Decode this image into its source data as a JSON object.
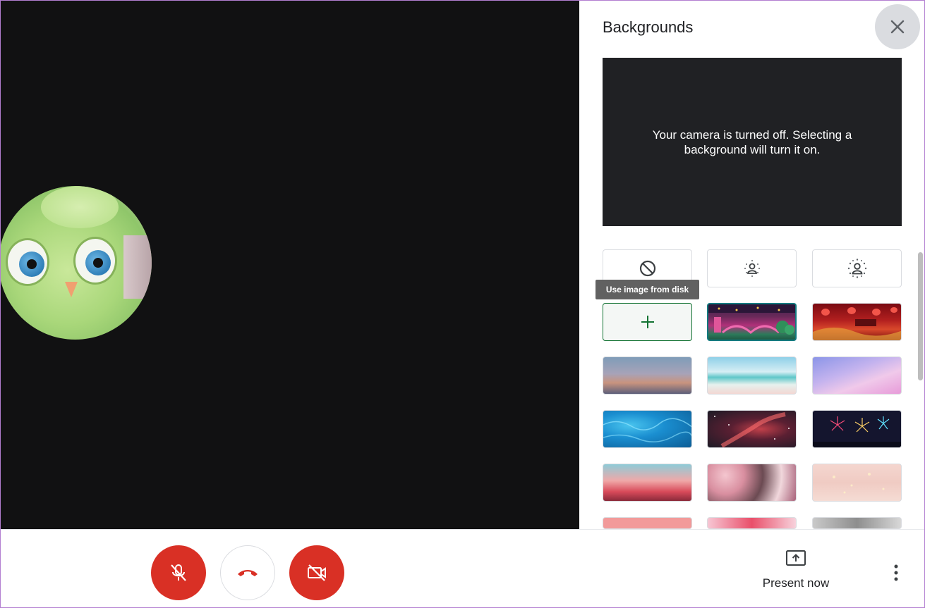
{
  "panel": {
    "title": "Backgrounds",
    "preview_message": "Your camera is turned off. Selecting a background will turn it on.",
    "tooltip": "Use image from disk",
    "options": [
      {
        "name": "no-effect",
        "icon": "block-icon"
      },
      {
        "name": "slight-blur",
        "icon": "blur-person-icon"
      },
      {
        "name": "blur",
        "icon": "blur-person-icon"
      }
    ],
    "add_icon": "plus-icon",
    "backgrounds": [
      {
        "name": "night-garden"
      },
      {
        "name": "red-lanterns"
      },
      {
        "name": "sunset-gradient"
      },
      {
        "name": "beach"
      },
      {
        "name": "pink-clouds"
      },
      {
        "name": "blue-water"
      },
      {
        "name": "nebula"
      },
      {
        "name": "fireworks"
      },
      {
        "name": "pink-flowers-sky"
      },
      {
        "name": "flower-field"
      },
      {
        "name": "pink-bokeh"
      },
      {
        "name": "pink-pattern"
      },
      {
        "name": "confetti"
      },
      {
        "name": "gray-interior"
      }
    ]
  },
  "toolbar": {
    "mic_state": "muted",
    "camera_state": "off",
    "present_label": "Present now"
  },
  "colors": {
    "accent_red": "#d93025",
    "selected_outline": "#137a7f",
    "add_border": "#137333"
  }
}
